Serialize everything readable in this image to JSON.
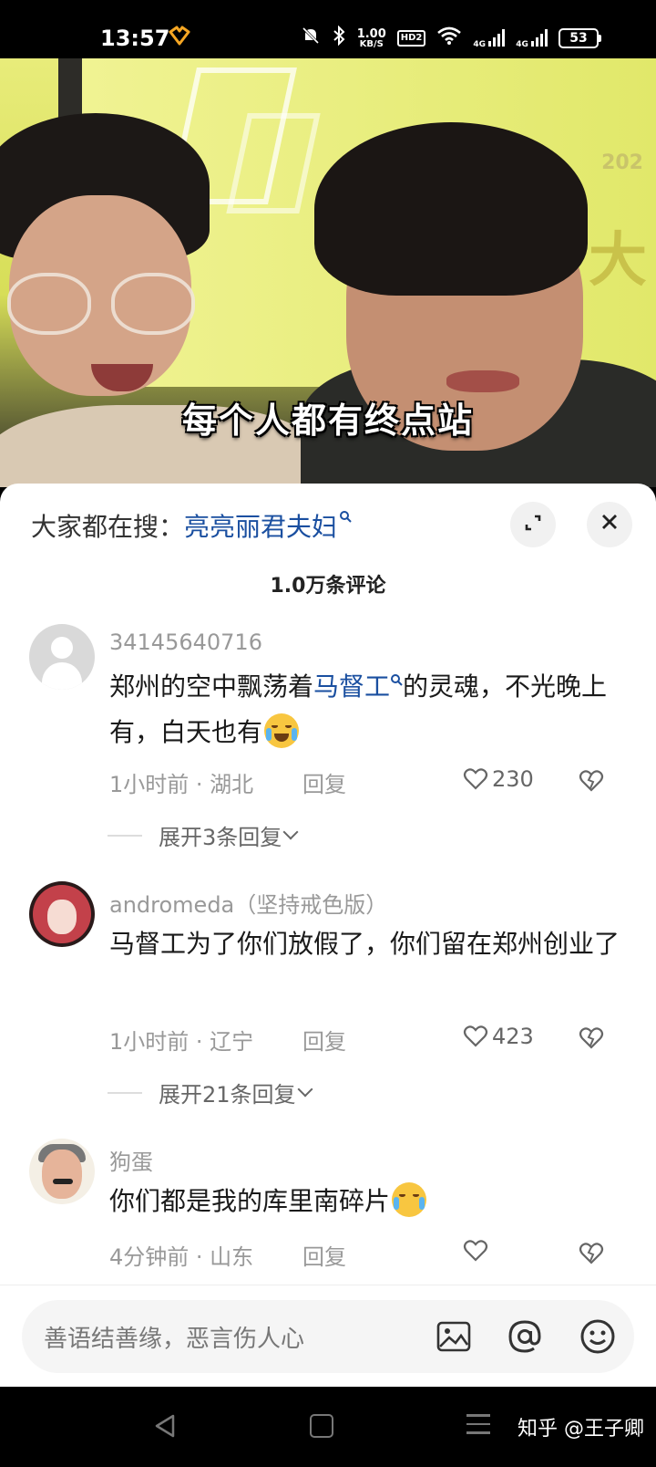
{
  "status_bar": {
    "time": "13:57",
    "net_speed_value": "1.00",
    "net_speed_unit": "KB/S",
    "hd_label": "HD2",
    "signal1_label": "4G",
    "signal2_label": "4G",
    "battery": "53",
    "icons": [
      "app-heart-icon",
      "mute-icon",
      "bluetooth-icon",
      "wifi-icon",
      "signal-icon",
      "battery-icon"
    ]
  },
  "video": {
    "caption": "每个人都有终点站",
    "wall_text": "大",
    "wall_year": "202"
  },
  "sheet": {
    "search_prefix": "大家都在搜：",
    "search_term": "亮亮丽君夫妇",
    "comment_count": "1.0万条评论",
    "expand_icon": "expand-icon",
    "close_icon": "close-icon"
  },
  "comments": [
    {
      "user": "34145640716",
      "text_before": "郑州的空中飘荡着",
      "link": "马督工",
      "text_after": "的灵魂，不光晚上有，白天也有",
      "meta": "1小时前 · 湖北",
      "reply": "回复",
      "likes": "230",
      "expand": "展开3条回复"
    },
    {
      "user": "andromeda（坚持戒色版）",
      "text": "马督工为了你们放假了，你们留在郑州创业了",
      "meta": "1小时前 · 辽宁",
      "reply": "回复",
      "likes": "423",
      "expand": "展开21条回复"
    },
    {
      "user": "狗蛋",
      "text": "你们都是我的库里南碎片",
      "meta": "4分钟前 · 山东",
      "reply": "回复"
    }
  ],
  "input_bar": {
    "placeholder": "善语结善缘，恶言伤人心",
    "icons": [
      "image-icon",
      "at-icon",
      "emoji-icon"
    ]
  },
  "nav_bar": {
    "watermark": "知乎 @王子卿"
  }
}
